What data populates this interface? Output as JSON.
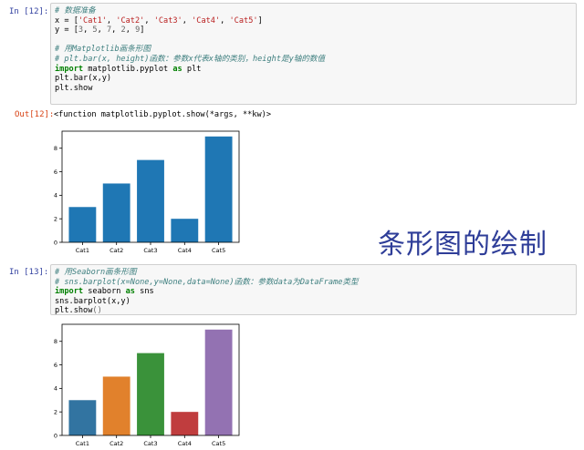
{
  "cell12": {
    "in_prompt": "In  [12]:",
    "lines": [
      [
        {
          "t": "# 数据准备",
          "c": "cm"
        }
      ],
      [
        {
          "t": "x = [",
          "c": ""
        },
        {
          "t": "'Cat1'",
          "c": "str"
        },
        {
          "t": ", ",
          "c": ""
        },
        {
          "t": "'Cat2'",
          "c": "str"
        },
        {
          "t": ", ",
          "c": ""
        },
        {
          "t": "'Cat3'",
          "c": "str"
        },
        {
          "t": ", ",
          "c": ""
        },
        {
          "t": "'Cat4'",
          "c": "str"
        },
        {
          "t": ", ",
          "c": ""
        },
        {
          "t": "'Cat5'",
          "c": "str"
        },
        {
          "t": "]",
          "c": ""
        }
      ],
      [
        {
          "t": "y = [",
          "c": ""
        },
        {
          "t": "3",
          "c": "num"
        },
        {
          "t": ", ",
          "c": ""
        },
        {
          "t": "5",
          "c": "num"
        },
        {
          "t": ", ",
          "c": ""
        },
        {
          "t": "7",
          "c": "num"
        },
        {
          "t": ", ",
          "c": ""
        },
        {
          "t": "2",
          "c": "num"
        },
        {
          "t": ", ",
          "c": ""
        },
        {
          "t": "9",
          "c": "num"
        },
        {
          "t": "]",
          "c": ""
        }
      ],
      [
        {
          "t": "",
          "c": ""
        }
      ],
      [
        {
          "t": "# 用Matplotlib画条形图",
          "c": "cm"
        }
      ],
      [
        {
          "t": "# plt.bar(x, height)函数：参数x代表x轴的类别，height是y轴的数值",
          "c": "cm"
        }
      ],
      [
        {
          "t": "import",
          "c": "kw"
        },
        {
          "t": " matplotlib.pyplot ",
          "c": ""
        },
        {
          "t": "as",
          "c": "kw"
        },
        {
          "t": " plt",
          "c": ""
        }
      ],
      [
        {
          "t": "plt.bar(x,y)",
          "c": ""
        }
      ],
      [
        {
          "t": "plt.show",
          "c": ""
        }
      ]
    ],
    "out_prompt": "Out[12]:",
    "out_text": "<function matplotlib.pyplot.show(*args, **kw)>"
  },
  "cell13": {
    "in_prompt": "In  [13]:",
    "lines": [
      [
        {
          "t": "# 用Seaborn画条形图",
          "c": "cm"
        }
      ],
      [
        {
          "t": "# sns.barplot(x=None,y=None,data=None)函数：参数data为DataFrame类型",
          "c": "cm"
        }
      ],
      [
        {
          "t": "import",
          "c": "kw"
        },
        {
          "t": " seaborn ",
          "c": ""
        },
        {
          "t": "as",
          "c": "kw"
        },
        {
          "t": " sns",
          "c": ""
        }
      ],
      [
        {
          "t": "sns.barplot(x,y)",
          "c": ""
        }
      ],
      [
        {
          "t": "plt.show",
          "c": ""
        },
        {
          "t": "()",
          "c": "num"
        }
      ]
    ]
  },
  "overlay_title": "条形图的绘制",
  "chart_data": [
    {
      "type": "bar",
      "categories": [
        "Cat1",
        "Cat2",
        "Cat3",
        "Cat4",
        "Cat5"
      ],
      "values": [
        3,
        5,
        7,
        2,
        9
      ],
      "yticks": [
        0,
        2,
        4,
        6,
        8
      ],
      "ylim": [
        0,
        9.45
      ],
      "colors": [
        "#1f77b4",
        "#1f77b4",
        "#1f77b4",
        "#1f77b4",
        "#1f77b4"
      ],
      "title": "",
      "xlabel": "",
      "ylabel": ""
    },
    {
      "type": "bar",
      "categories": [
        "Cat1",
        "Cat2",
        "Cat3",
        "Cat4",
        "Cat5"
      ],
      "values": [
        3,
        5,
        7,
        2,
        9
      ],
      "yticks": [
        0,
        2,
        4,
        6,
        8
      ],
      "ylim": [
        0,
        9.45
      ],
      "colors": [
        "#3274a1",
        "#e1812c",
        "#3a923a",
        "#c03d3e",
        "#9372b2"
      ],
      "title": "",
      "xlabel": "",
      "ylabel": ""
    }
  ]
}
